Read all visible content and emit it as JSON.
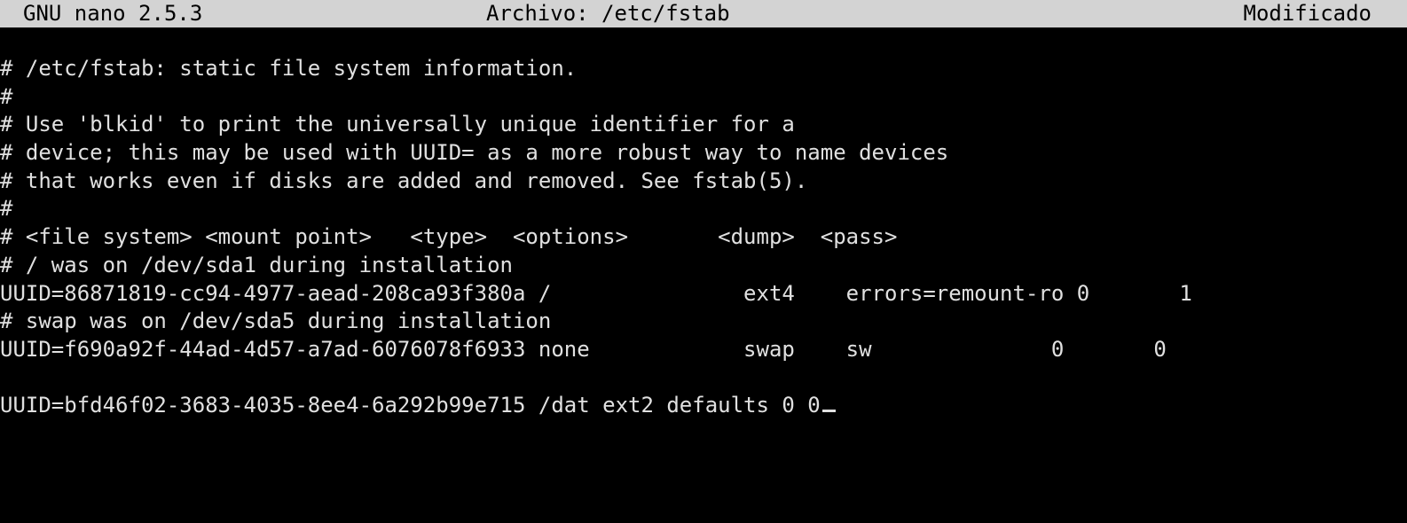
{
  "titlebar": {
    "app": "GNU nano 2.5.3",
    "file": "Archivo: /etc/fstab",
    "status": "Modificado"
  },
  "editor": {
    "lines": [
      "# /etc/fstab: static file system information.",
      "#",
      "# Use 'blkid' to print the universally unique identifier for a",
      "# device; this may be used with UUID= as a more robust way to name devices",
      "# that works even if disks are added and removed. See fstab(5).",
      "#",
      "# <file system> <mount point>   <type>  <options>       <dump>  <pass>",
      "# / was on /dev/sda1 during installation",
      "UUID=86871819-cc94-4977-aead-208ca93f380a /               ext4    errors=remount-ro 0       1",
      "# swap was on /dev/sda5 during installation",
      "UUID=f690a92f-44ad-4d57-a7ad-6076078f6933 none            swap    sw              0       0",
      "",
      "UUID=bfd46f02-3683-4035-8ee4-6a292b99e715 /dat ext2 defaults 0 0"
    ]
  },
  "colors": {
    "background": "#000000",
    "foreground": "#e0e0e0",
    "titlebar_bg": "#d3d3d3",
    "titlebar_fg": "#000000"
  }
}
